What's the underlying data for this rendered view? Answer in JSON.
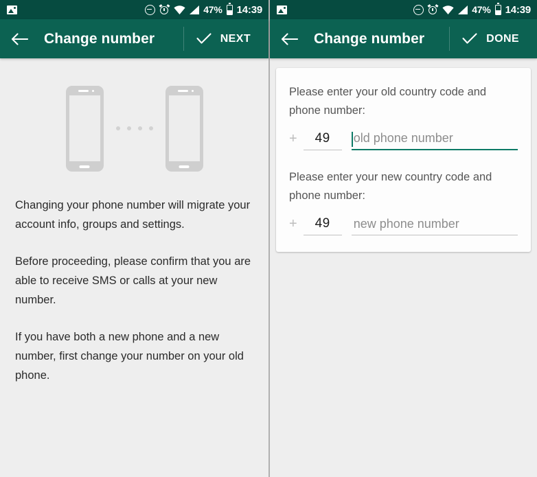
{
  "status_bar": {
    "photo_icon": "photo-icon",
    "dnd_icon": "do-not-disturb-icon",
    "alarm_icon": "alarm-icon",
    "wifi_icon": "wifi-icon",
    "signal_icon": "cell-signal-icon",
    "battery_percent": "47%",
    "battery_icon": "battery-icon",
    "time": "14:39"
  },
  "left_screen": {
    "app_bar": {
      "back_icon": "back-arrow-icon",
      "title": "Change number",
      "action_icon": "check-icon",
      "action_label": "NEXT"
    },
    "illustration": {
      "phone_left": "phone-outline",
      "phone_right": "phone-outline",
      "dot_count": 4
    },
    "paragraphs": [
      "Changing your phone number will migrate your account info, groups and settings.",
      "Before proceeding, please confirm that you are able to receive SMS or calls at your new number.",
      "If you have both a new phone and a new number, first change your number on your old phone."
    ]
  },
  "right_screen": {
    "app_bar": {
      "back_icon": "back-arrow-icon",
      "title": "Change number",
      "action_icon": "check-icon",
      "action_label": "DONE"
    },
    "form": {
      "old": {
        "label": "Please enter your old country code and phone number:",
        "plus": "+",
        "country_code": "49",
        "placeholder": "old phone number",
        "value": "",
        "focused": true
      },
      "new": {
        "label": "Please enter your new country code and phone number:",
        "plus": "+",
        "country_code": "49",
        "placeholder": "new phone number",
        "value": "",
        "focused": false
      }
    }
  },
  "colors": {
    "status_bar": "#064b40",
    "app_bar": "#0c6252",
    "accent": "#0c7a66",
    "background": "#eeeeee",
    "card": "#fdfdfd"
  }
}
